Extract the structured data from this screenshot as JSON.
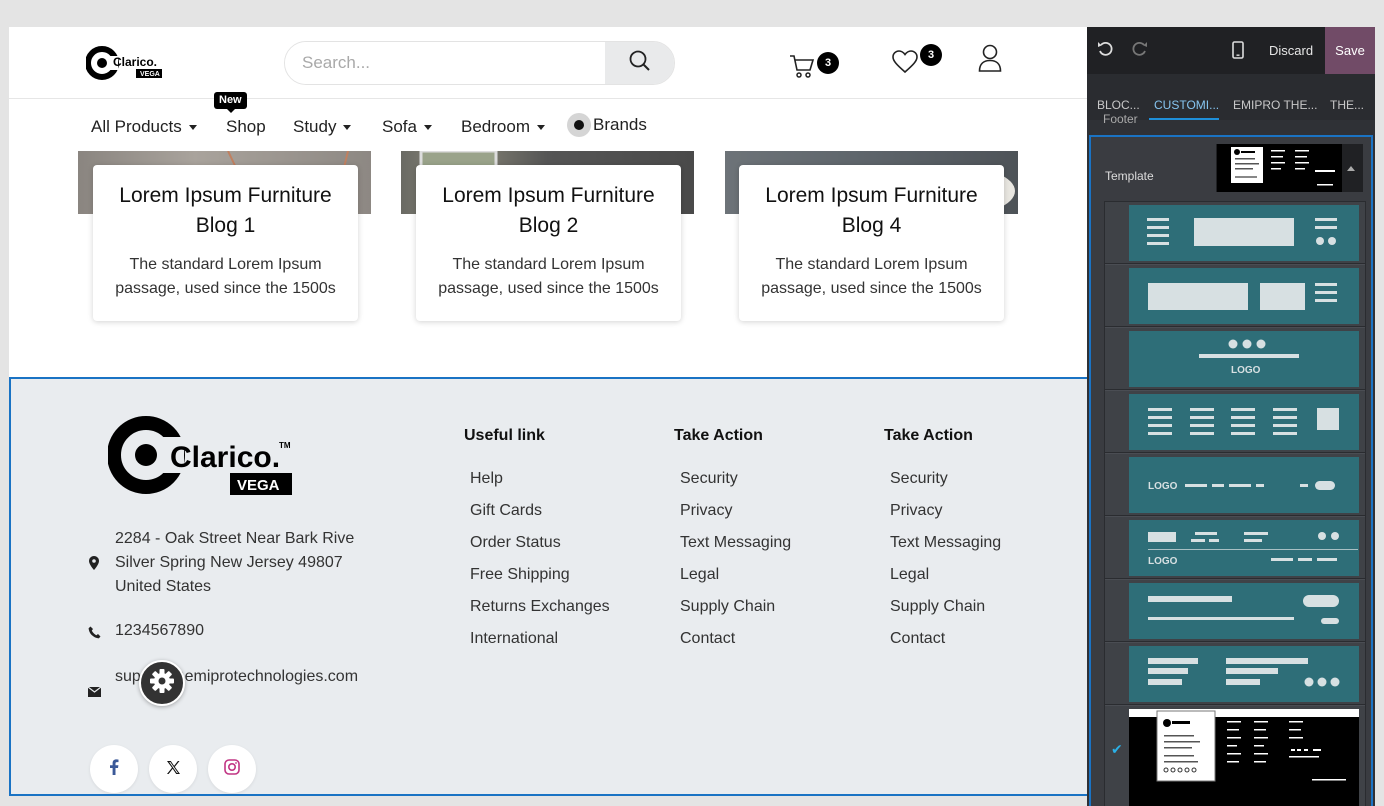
{
  "header": {
    "search_placeholder": "Search...",
    "cart_count": "3",
    "wishlist_count": "3",
    "nav": [
      {
        "label": "All Products"
      },
      {
        "label": "Shop",
        "badge": "New"
      },
      {
        "label": "Study"
      },
      {
        "label": "Sofa"
      },
      {
        "label": "Bedroom"
      },
      {
        "label": "Brands"
      }
    ]
  },
  "blogs": [
    {
      "title": "Lorem Ipsum Furniture Blog 1",
      "text": "The standard Lorem Ipsum passage, used since the 1500s"
    },
    {
      "title": "Lorem Ipsum Furniture Blog 2",
      "text": "The standard Lorem Ipsum passage, used since the 1500s"
    },
    {
      "title": "Lorem Ipsum Furniture Blog 4",
      "text": "The standard Lorem Ipsum passage, used since the 1500s"
    }
  ],
  "footer": {
    "address": "2284 - Oak Street Near Bark Rive Silver Spring New Jersey 49807 United States",
    "phone": "1234567890",
    "email": "support@emiprotechnologies.com",
    "columns": [
      {
        "title": "Useful link",
        "links": [
          "Help",
          "Gift Cards",
          "Order Status",
          "Free Shipping",
          "Returns Exchanges",
          "International"
        ]
      },
      {
        "title": "Take Action",
        "links": [
          "Security",
          "Privacy",
          "Text Messaging",
          "Legal",
          "Supply Chain",
          "Contact"
        ]
      },
      {
        "title": "Take Action",
        "links": [
          "Security",
          "Privacy",
          "Text Messaging",
          "Legal",
          "Supply Chain",
          "Contact"
        ]
      }
    ],
    "social": [
      "facebook-icon",
      "x-twitter-icon",
      "instagram-icon"
    ]
  },
  "editor": {
    "discard_label": "Discard",
    "save_label": "Save",
    "tabs": [
      "BLOC...",
      "CUSTOMI...",
      "EMIPRO THE...",
      "THE..."
    ],
    "active_tab": 1,
    "section_label": "Footer",
    "template_label": "Template",
    "thumb_logo_text": "LOGO",
    "selected_template_index": 8
  },
  "colors": {
    "accent_blue": "#1a73c4",
    "save_purple": "#714b67",
    "thumb_teal": "#2e6e78",
    "footer_bg": "#e9ecef"
  }
}
